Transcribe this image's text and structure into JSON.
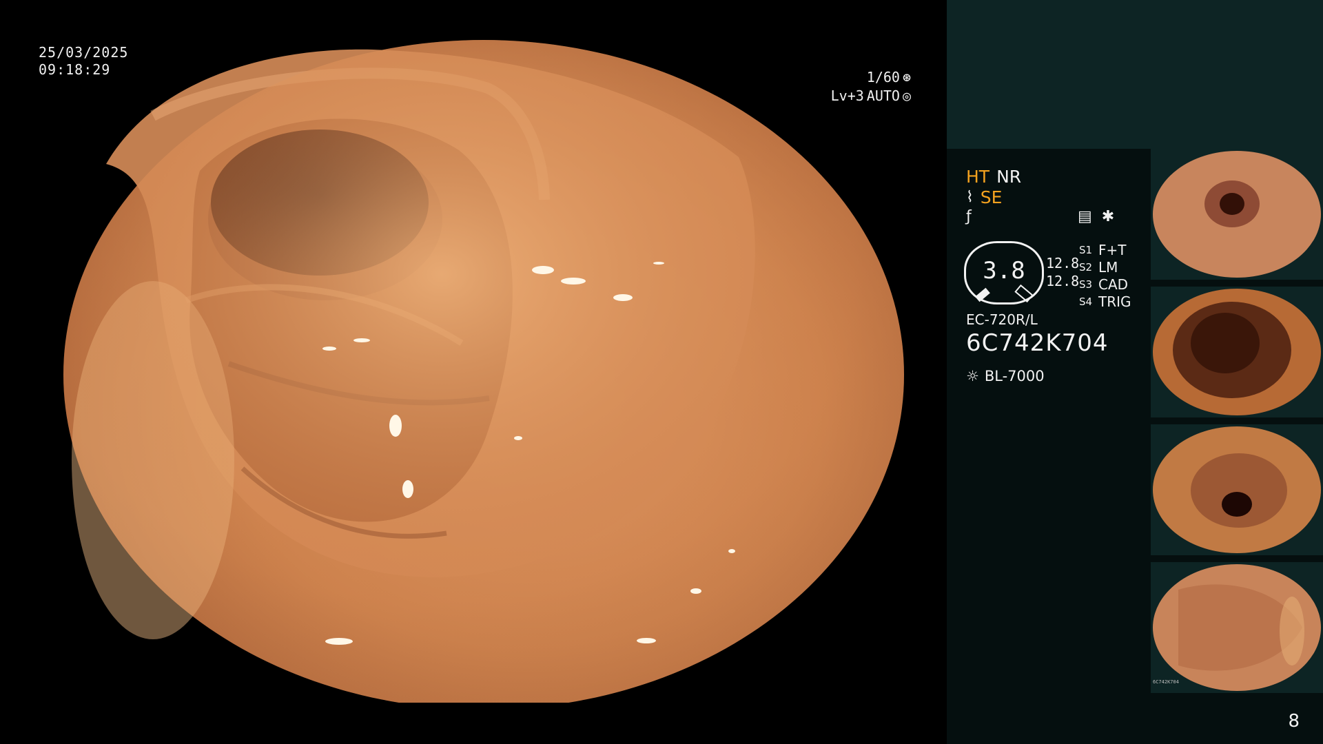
{
  "overlay": {
    "date": "25/03/2025",
    "time": "09:18:29",
    "shutter": "1/60",
    "level": "Lv+3",
    "iris": "AUTO"
  },
  "modes": {
    "ht": "HT",
    "nr": "NR",
    "se": "SE"
  },
  "dial_value": "3.8",
  "exposure_values": [
    "12.8",
    "12.8"
  ],
  "switches": [
    {
      "key": "S1",
      "value": "F+T"
    },
    {
      "key": "S2",
      "value": "LM"
    },
    {
      "key": "S3",
      "value": "CAD"
    },
    {
      "key": "S4",
      "value": "TRIG"
    }
  ],
  "scope_model": "EC-720R/L",
  "serial_number": "6C742K704",
  "light_source": "BL-7000",
  "thumbnail_caption": "6C742K704",
  "page_number": "8",
  "colors": {
    "accent": "#f4a21f",
    "panel": "#050f0f",
    "panel_top": "#0d2424",
    "tissue": "#d58b5f"
  },
  "icons": {
    "shutter": "aperture-icon",
    "iris": "target-icon",
    "settings": "scope-settings-icon",
    "light": "light-bulb-icon"
  }
}
